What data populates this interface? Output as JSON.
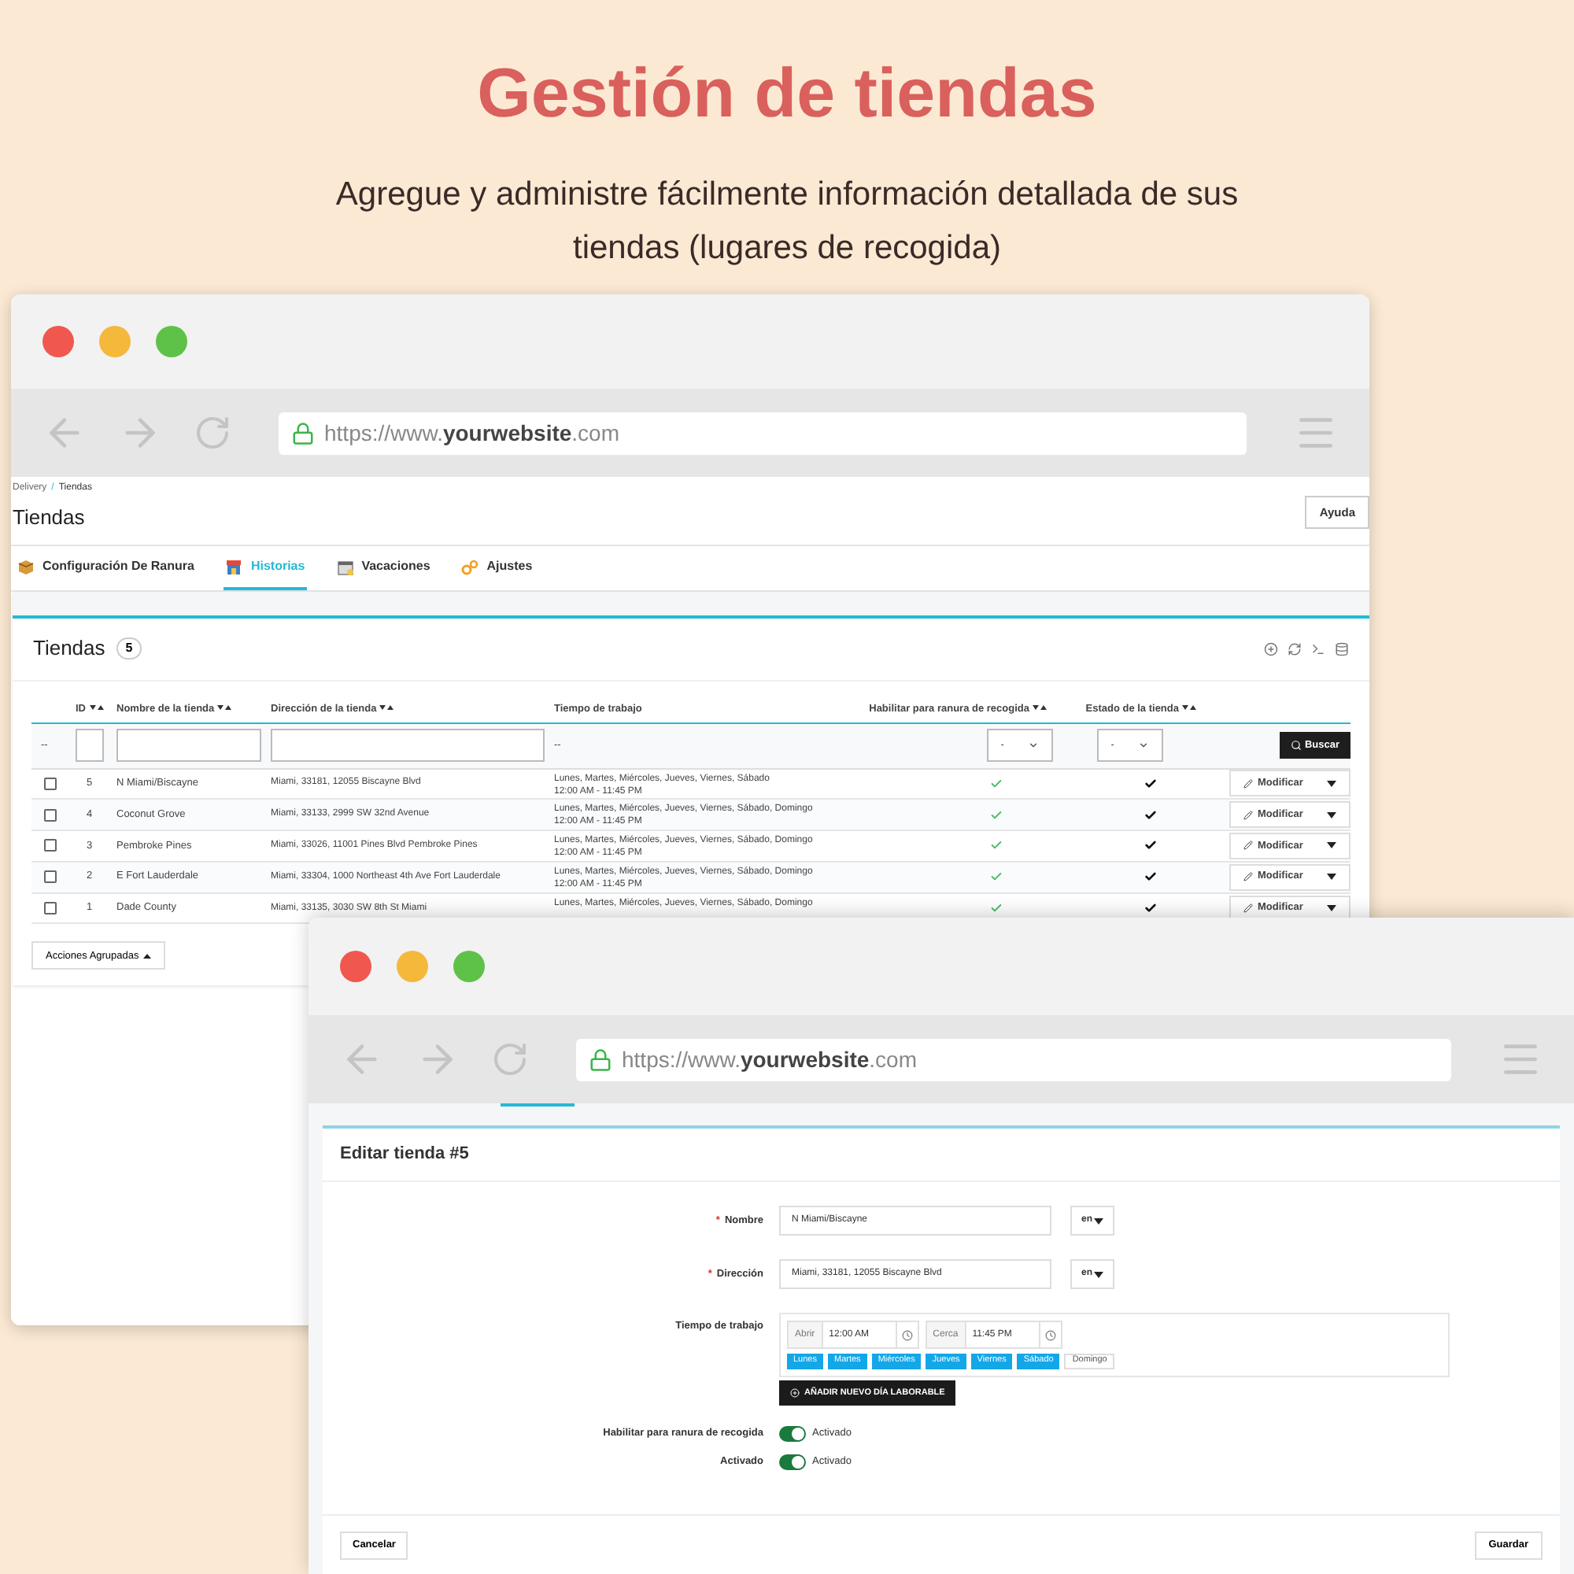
{
  "heading": "Gestión de tiendas",
  "subheading": "Agregue y administre fácilmente información detallada de sus tiendas (lugares de recogida)",
  "list_window": {
    "url": "https://www.**yourwebsite**.com",
    "breadcrumb": [
      "Delivery",
      "Tiendas"
    ],
    "breadcrumb_separator": "/",
    "page_title": "Tiendas",
    "help_button": "Ayuda",
    "tabs": [
      {
        "label": "Configuración De Ranura",
        "kind": "box",
        "selected": false
      },
      {
        "label": "Historias",
        "kind": "store",
        "selected": true
      },
      {
        "label": "Vacaciones",
        "kind": "calendar",
        "selected": false
      },
      {
        "label": "Ajustes",
        "kind": "gears",
        "selected": false
      }
    ],
    "panel": {
      "title": "Tiendas",
      "count": "5",
      "columns": [
        {
          "label": "ID",
          "sortable": true
        },
        {
          "label": "Nombre de la tienda",
          "sortable": true
        },
        {
          "label": "Dirección de la tienda",
          "sortable": true
        },
        {
          "label": "Tiempo de trabajo",
          "sortable": false
        },
        {
          "label": "Habilitar para ranura de recogida",
          "sortable": true
        },
        {
          "label": "Estado de la tienda",
          "sortable": true
        }
      ],
      "filter_row": {
        "first_cell": "--",
        "time_cell": "--",
        "pickup_select": "-",
        "status_select": "-",
        "search_button": "Buscar"
      },
      "rows": [
        {
          "checked": false,
          "id": "5",
          "name": "N Miami/Biscayne",
          "address": "Miami, 33181, 12055 Biscayne Blvd",
          "days": "Lunes, Martes, Miércoles, Jueves, Viernes, Sábado",
          "hours": "12:00 AM - 11:45 PM",
          "pickup": true,
          "active": true,
          "action": "Modificar"
        },
        {
          "checked": false,
          "id": "4",
          "name": "Coconut Grove",
          "address": "Miami, 33133, 2999 SW 32nd Avenue",
          "days": "Lunes, Martes, Miércoles, Jueves, Viernes, Sábado, Domingo",
          "hours": "12:00 AM - 11:45 PM",
          "pickup": true,
          "active": true,
          "action": "Modificar"
        },
        {
          "checked": false,
          "id": "3",
          "name": "Pembroke Pines",
          "address": "Miami, 33026, 11001 Pines Blvd Pembroke Pines",
          "days": "Lunes, Martes, Miércoles, Jueves, Viernes, Sábado, Domingo",
          "hours": "12:00 AM - 11:45 PM",
          "pickup": true,
          "active": true,
          "action": "Modificar"
        },
        {
          "checked": false,
          "id": "2",
          "name": "E Fort Lauderdale",
          "address": "Miami, 33304, 1000 Northeast 4th Ave Fort Lauderdale",
          "days": "Lunes, Martes, Miércoles, Jueves, Viernes, Sábado, Domingo",
          "hours": "12:00 AM - 11:45 PM",
          "pickup": true,
          "active": true,
          "action": "Modificar"
        },
        {
          "checked": false,
          "id": "1",
          "name": "Dade County",
          "address": "Miami, 33135, 3030 SW 8th St Miami",
          "days": "Lunes, Martes, Miércoles, Jueves, Viernes, Sábado, Domingo",
          "pickup": true,
          "active": true,
          "action": "Modificar"
        }
      ],
      "bulk_button": "Acciones Agrupadas"
    }
  },
  "edit_window": {
    "url": "https://www.**yourwebsite**.com",
    "title": "Editar tienda #5",
    "fields": [
      {
        "label": "Nombre",
        "required_mark": "*",
        "value": "N Miami/Biscayne",
        "language": "en"
      },
      {
        "label": "Dirección",
        "required_mark": "*",
        "value": "Miami, 33181, 12055 Biscayne Blvd",
        "language": "en"
      }
    ],
    "work_time": {
      "label": "Tiempo de trabajo",
      "open_label": "Abrir",
      "open_value": "12:00 AM",
      "close_label": "Cerca",
      "close_value": "11:45 PM",
      "days": [
        {
          "label": "Lunes",
          "selected": true
        },
        {
          "label": "Martes",
          "selected": true
        },
        {
          "label": "Miércoles",
          "selected": true
        },
        {
          "label": "Jueves",
          "selected": true
        },
        {
          "label": "Viernes",
          "selected": true
        },
        {
          "label": "Sábado",
          "selected": true
        },
        {
          "label": "Domingo",
          "selected": false
        }
      ],
      "add_button": "AÑADIR NUEVO DÍA LABORABLE"
    },
    "toggles": [
      {
        "label": "Habilitar para ranura de recogida",
        "on": true,
        "state_text": "Activado"
      },
      {
        "label": "Activado",
        "on": true,
        "state_text": "Activado"
      }
    ],
    "cancel_button": "Cancelar",
    "save_button": "Guardar"
  }
}
